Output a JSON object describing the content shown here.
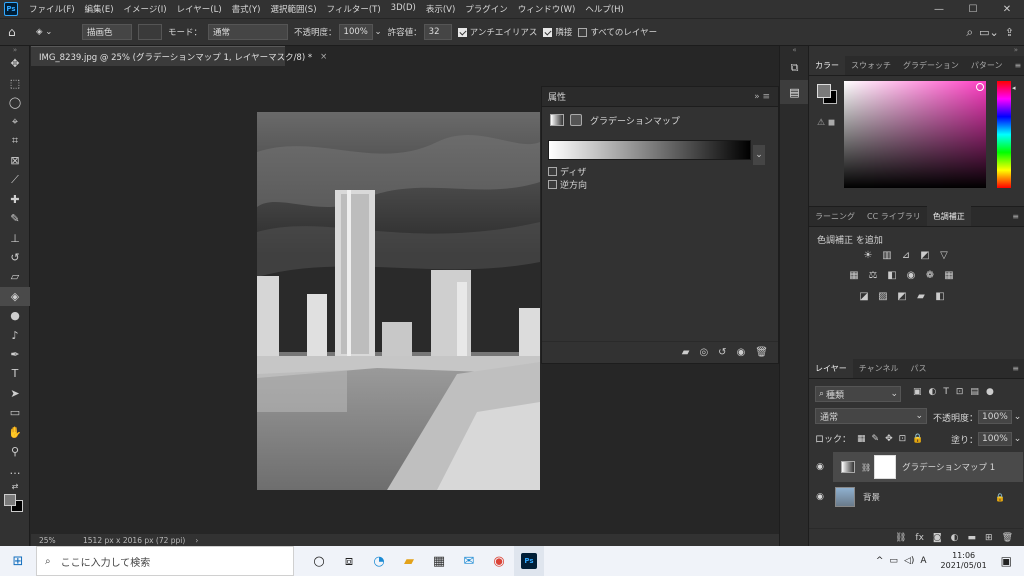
{
  "app": {
    "logo": "Ps"
  },
  "menu": [
    "ファイル(F)",
    "編集(E)",
    "イメージ(I)",
    "レイヤー(L)",
    "書式(Y)",
    "選択範囲(S)",
    "フィルター(T)",
    "3D(D)",
    "表示(V)",
    "プラグイン",
    "ウィンドウ(W)",
    "ヘルプ(H)"
  ],
  "options": {
    "fill_source": "描画色",
    "mode_label": "モード：",
    "mode_value": "通常",
    "opacity_label": "不透明度：",
    "opacity_value": "100%",
    "tolerance_label": "許容値：",
    "tolerance_value": "32",
    "antialias_label": "アンチエイリアス",
    "antialias_checked": true,
    "contiguous_label": "隣接",
    "contiguous_checked": true,
    "all_layers_label": "すべてのレイヤー",
    "all_layers_checked": false
  },
  "document": {
    "tab_title": "IMG_8239.jpg @ 25% (グラデーションマップ 1, レイヤーマスク/8) *",
    "zoom": "25%",
    "size_info": "1512 px x 2016 px (72 ppi)"
  },
  "properties": {
    "title": "属性",
    "adjustment_name": "グラデーションマップ",
    "dither_label": "ディザ",
    "reverse_label": "逆方向",
    "dither_checked": false,
    "reverse_checked": false
  },
  "color_panel": {
    "tabs": [
      "カラー",
      "スウォッチ",
      "グラデーション",
      "パターン"
    ],
    "active_tab": "カラー",
    "foreground": "#7a7a7a",
    "background": "#000000"
  },
  "adjustments_panel": {
    "tabs": [
      "ラーニング",
      "CC ライブラリ",
      "色調補正"
    ],
    "active_tab": "色調補正",
    "add_label": "色調補正 を追加"
  },
  "layers_panel": {
    "tabs": [
      "レイヤー",
      "チャンネル",
      "パス"
    ],
    "active_tab": "レイヤー",
    "filter_label": "種類",
    "blend_mode": "通常",
    "opacity_label": "不透明度：",
    "opacity_value": "100%",
    "lock_label": "ロック：",
    "fill_label": "塗り：",
    "fill_value": "100%",
    "layers": [
      {
        "name": "グラデーションマップ 1",
        "selected": true
      },
      {
        "name": "背景",
        "selected": false
      }
    ]
  },
  "taskbar": {
    "search_placeholder": "ここに入力して検索",
    "time": "11:06",
    "date": "2021/05/01",
    "ime": "A"
  }
}
